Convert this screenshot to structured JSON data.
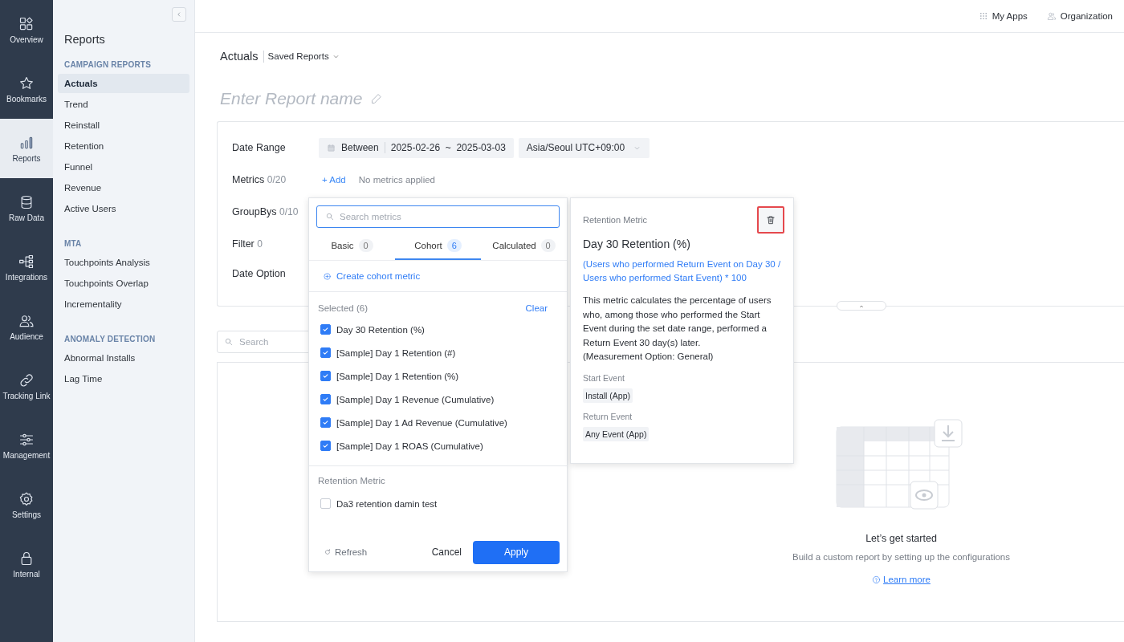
{
  "nav": [
    {
      "label": "Overview",
      "selected": false
    },
    {
      "label": "Bookmarks",
      "selected": false
    },
    {
      "label": "Reports",
      "selected": true
    },
    {
      "label": "Raw Data",
      "selected": false
    },
    {
      "label": "Integrations",
      "selected": false
    },
    {
      "label": "Audience",
      "selected": false
    },
    {
      "label": "Tracking Link",
      "selected": false
    },
    {
      "label": "Management",
      "selected": false
    },
    {
      "label": "Settings",
      "selected": false
    },
    {
      "label": "Internal",
      "selected": false
    }
  ],
  "sidebar": {
    "title": "Reports",
    "sections": [
      {
        "heading": "CAMPAIGN REPORTS",
        "items": [
          {
            "label": "Actuals",
            "selected": true
          },
          {
            "label": "Trend",
            "selected": false
          },
          {
            "label": "Reinstall",
            "selected": false
          },
          {
            "label": "Retention",
            "selected": false
          },
          {
            "label": "Funnel",
            "selected": false
          },
          {
            "label": "Revenue",
            "selected": false
          },
          {
            "label": "Active Users",
            "selected": false
          }
        ]
      },
      {
        "heading": "MTA",
        "items": [
          {
            "label": "Touchpoints Analysis",
            "selected": false
          },
          {
            "label": "Touchpoints Overlap",
            "selected": false
          },
          {
            "label": "Incrementality",
            "selected": false
          }
        ]
      },
      {
        "heading": "ANOMALY DETECTION",
        "items": [
          {
            "label": "Abnormal Installs",
            "selected": false
          },
          {
            "label": "Lag Time",
            "selected": false
          }
        ]
      }
    ]
  },
  "topbar": {
    "links": [
      {
        "label": "My Apps"
      },
      {
        "label": "Organization"
      }
    ]
  },
  "breadcrumb": {
    "title": "Actuals",
    "saved_reports": "Saved Reports"
  },
  "report_name": {
    "placeholder": "Enter Report name"
  },
  "config": {
    "rows": [
      {
        "kind": "date",
        "label": "Date Range",
        "mode": "Between",
        "start": "2025-02-26",
        "separator": "~",
        "end": "2025-03-03",
        "timezone": "Asia/Seoul UTC+09:00"
      },
      {
        "kind": "metrics",
        "label": "Metrics",
        "count": "0/20",
        "add": "+ Add",
        "empty": "No metrics applied"
      },
      {
        "kind": "plain",
        "label": "GroupBys",
        "count": "0/10"
      },
      {
        "kind": "plain",
        "label": "Filter",
        "count": "0"
      },
      {
        "kind": "plain",
        "label": "Date Option"
      }
    ]
  },
  "table_search": {
    "placeholder": "Search"
  },
  "empty_state": {
    "title": "Let’s get started",
    "subtitle": "Build a custom report by setting up the configurations",
    "link": "Learn more"
  },
  "metric_picker": {
    "search": {
      "placeholder": "Search metrics"
    },
    "tabs": [
      {
        "label": "Basic",
        "count": "0",
        "selected": false
      },
      {
        "label": "Cohort",
        "count": "6",
        "selected": true
      },
      {
        "label": "Calculated",
        "count": "0",
        "selected": false
      }
    ],
    "create": "Create cohort metric",
    "selected_heading": "Selected (6)",
    "clear": "Clear",
    "selected_items": [
      {
        "label": "Day 30 Retention (%)",
        "checked": true
      },
      {
        "label": "[Sample] Day 1 Retention (#)",
        "checked": true
      },
      {
        "label": "[Sample] Day 1 Retention (%)",
        "checked": true
      },
      {
        "label": "[Sample] Day 1 Revenue (Cumulative)",
        "checked": true
      },
      {
        "label": "[Sample] Day 1 Ad Revenue (Cumulative)",
        "checked": true
      },
      {
        "label": "[Sample] Day 1 ROAS (Cumulative)",
        "checked": true
      }
    ],
    "group_heading": "Retention Metric",
    "group_items": [
      {
        "label": "Da3 retention damin test",
        "checked": false
      }
    ],
    "refresh": "Refresh",
    "cancel": "Cancel",
    "apply": "Apply"
  },
  "metric_detail": {
    "category": "Retention Metric",
    "name": "Day 30 Retention (%)",
    "formula": "(Users who performed Return Event on Day 30 / Users who performed Start Event) * 100",
    "description": "This metric calculates the percentage of users who, among those who performed the Start Event during the set date range, performed a Return Event 30 day(s) later.",
    "note": "(Measurement Option: General)",
    "events": [
      {
        "label": "Start Event",
        "value": "Install (App)"
      },
      {
        "label": "Return Event",
        "value": "Any Event (App)"
      }
    ]
  }
}
